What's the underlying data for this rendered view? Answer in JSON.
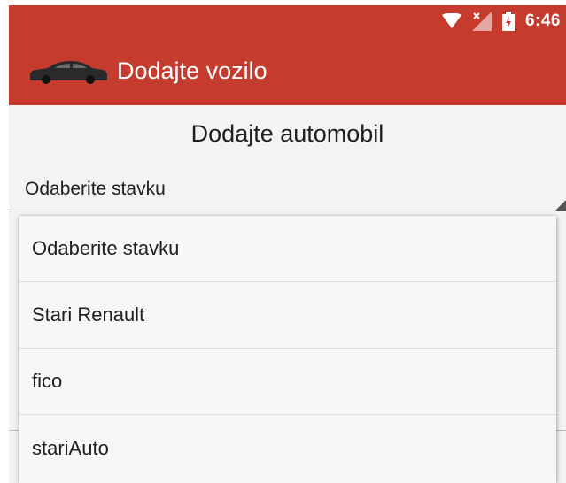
{
  "status_bar": {
    "time": "6:46",
    "icons": [
      "wifi-icon",
      "no-signal-icon",
      "battery-charging-icon"
    ]
  },
  "app_bar": {
    "icon": "car-icon",
    "title": "Dodajte vozilo"
  },
  "content": {
    "title": "Dodajte automobil",
    "spinner": {
      "selected": "Odaberite stavku"
    }
  },
  "dropdown": {
    "options": [
      "Odaberite stavku",
      "Stari Renault",
      "fico",
      "stariAuto"
    ]
  },
  "colors": {
    "primary": "#c53c2f",
    "background": "#f3f3f3"
  }
}
